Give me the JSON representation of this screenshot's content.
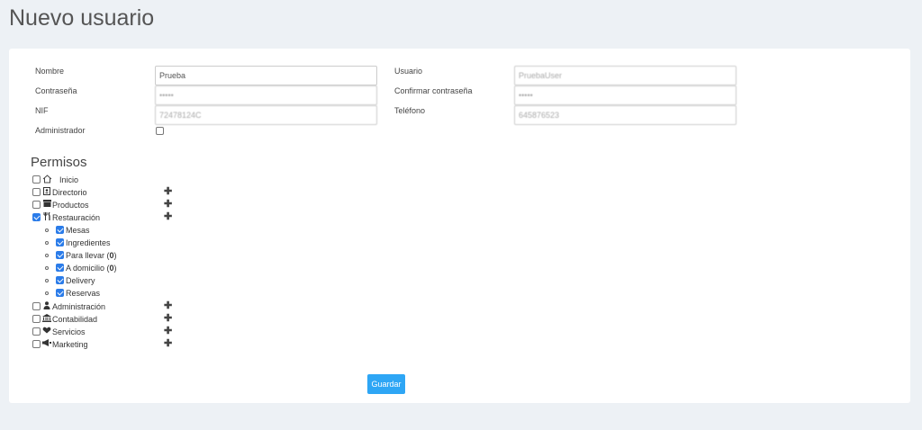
{
  "page": {
    "title": "Nuevo usuario"
  },
  "form": {
    "nombre_label": "Nombre",
    "nombre_value": "Prueba",
    "usuario_label": "Usuario",
    "usuario_value": "PruebaUser",
    "contrasena_label": "Contraseña",
    "contrasena_value": "•••••",
    "confirmar_label": "Confirmar contraseña",
    "confirmar_value": "•••••",
    "nif_label": "NIF",
    "nif_value": "72478124C",
    "telefono_label": "Teléfono",
    "telefono_value": "645876523",
    "admin_label": "Administrador",
    "admin_checked": false
  },
  "permisos": {
    "title": "Permisos",
    "items": [
      {
        "label": "Inicio",
        "icon": "home-icon",
        "checked": false,
        "expandable": false
      },
      {
        "label": "Directorio",
        "icon": "contact-book-icon",
        "checked": false,
        "expandable": true
      },
      {
        "label": "Productos",
        "icon": "box-icon",
        "checked": false,
        "expandable": true
      },
      {
        "label": "Restauración",
        "icon": "cutlery-icon",
        "checked": true,
        "expandable": true
      },
      {
        "label": "Administración",
        "icon": "user-tie-icon",
        "checked": false,
        "expandable": true
      },
      {
        "label": "Contabilidad",
        "icon": "bank-icon",
        "checked": false,
        "expandable": true
      },
      {
        "label": "Servicios",
        "icon": "handshake-icon",
        "checked": false,
        "expandable": true
      },
      {
        "label": "Marketing",
        "icon": "megaphone-icon",
        "checked": false,
        "expandable": true
      }
    ],
    "restauracion_children": [
      {
        "label": "Mesas",
        "checked": true
      },
      {
        "label": "Ingredientes",
        "checked": true
      },
      {
        "label": "Para llevar (",
        "count": "0",
        "suffix": ")",
        "checked": true
      },
      {
        "label": "A domicilio (",
        "count": "0",
        "suffix": ")",
        "checked": true
      },
      {
        "label": "Delivery",
        "checked": true
      },
      {
        "label": "Reservas",
        "checked": true
      }
    ],
    "expand_symbol": "✚"
  },
  "actions": {
    "save_label": "Guardar"
  },
  "colors": {
    "accent": "#2ea6f5",
    "checkbox": "#2b7ce9",
    "background": "#edf1f5"
  }
}
